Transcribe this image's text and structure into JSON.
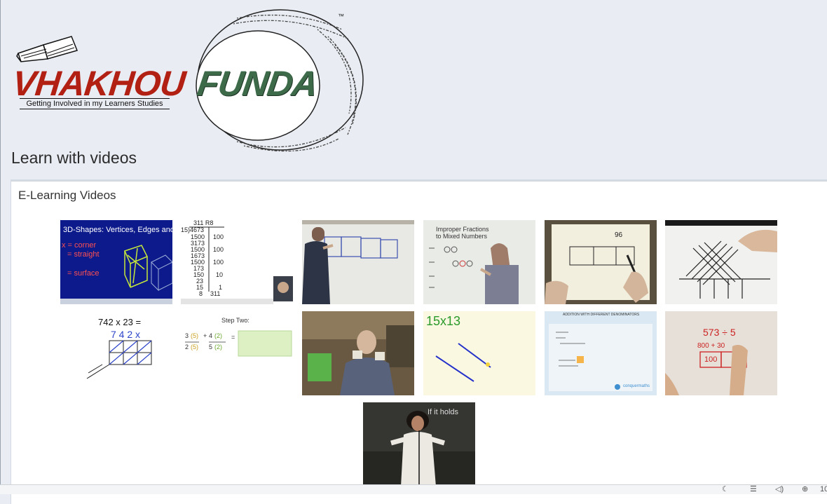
{
  "logo": {
    "brand_left": "VHAKHOU",
    "brand_right": "FUNDA",
    "tagline": "Getting Involved in my Learners Studies",
    "trademark": "™"
  },
  "page": {
    "title": "Learn with videos"
  },
  "panel": {
    "title": "E-Learning Videos"
  },
  "videos": [
    {
      "text": "3D-Shapes: Vertices, Edges and Faces",
      "lines": [
        "x = corner",
        "= straight",
        "= surface"
      ]
    },
    {
      "text": "311 R8",
      "lines": [
        "15)4673",
        "1500",
        "3173",
        "1500",
        "1673",
        "1500",
        "173",
        "150",
        "23",
        "15",
        "8"
      ],
      "side": [
        "100",
        "100",
        "100",
        "10",
        "1",
        "311"
      ]
    },
    {
      "text": ""
    },
    {
      "text": "Improper Fractions to Mixed Numbers"
    },
    {
      "text": "96"
    },
    {
      "text": ""
    },
    {
      "text": "742 x 23 =",
      "digits": "7 4 2 x"
    },
    {
      "text": "Step Two:"
    },
    {
      "text": ""
    },
    {
      "text": "15x13"
    },
    {
      "text": "ADDITION WITH DIFFERENT DENOMINATORS",
      "brand": "conquermaths"
    },
    {
      "text": "573 ÷ 5",
      "lines": [
        "800 + 30",
        "100"
      ]
    },
    {
      "text": "If it holds"
    }
  ],
  "status_bar": {
    "icons": [
      "moon-icon",
      "list-icon",
      "speaker-icon",
      "zoom-in-icon"
    ],
    "zoom": "10"
  }
}
